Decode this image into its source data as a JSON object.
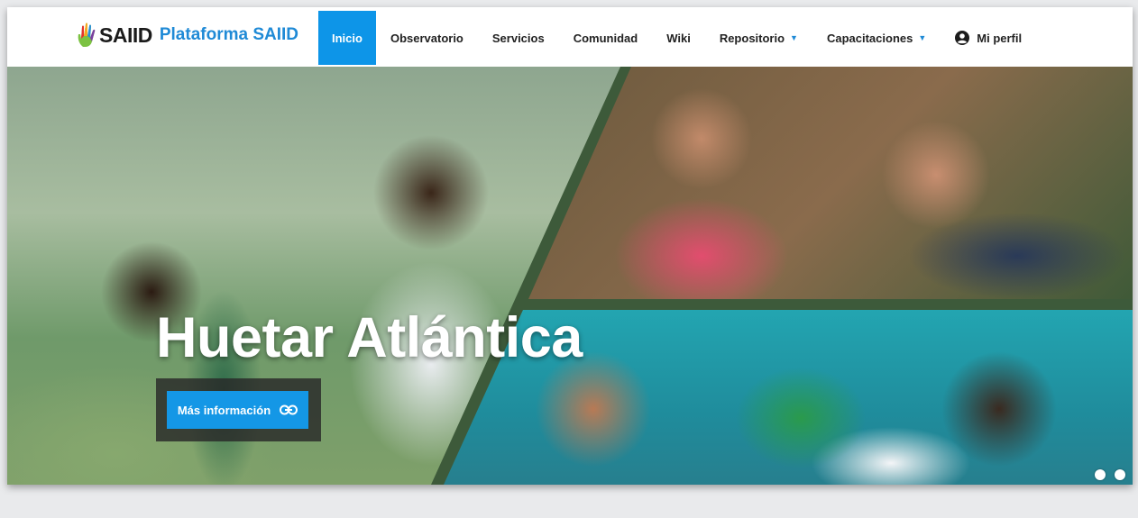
{
  "logo": {
    "brand": "SAIID",
    "platform": "Plataforma SAIID"
  },
  "nav": {
    "items": [
      {
        "label": "Inicio",
        "active": true
      },
      {
        "label": "Observatorio"
      },
      {
        "label": "Servicios"
      },
      {
        "label": "Comunidad"
      },
      {
        "label": "Wiki"
      },
      {
        "label": "Repositorio",
        "dropdown": true
      },
      {
        "label": "Capacitaciones",
        "dropdown": true
      },
      {
        "label": "Mi perfil",
        "icon": "user-circle-icon"
      }
    ]
  },
  "hero": {
    "title": "Huetar Atlántica",
    "cta_label": "Más información",
    "cta_icon": "link-icon",
    "slide_count": 2
  },
  "colors": {
    "accent": "#0d95e8",
    "brand_blue": "#1f8ad6",
    "cta_bg": "#1497e6"
  }
}
